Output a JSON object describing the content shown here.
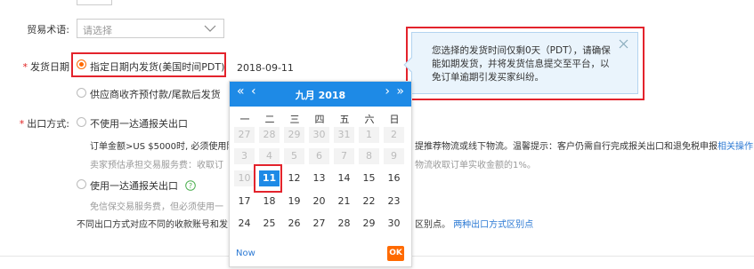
{
  "trade_terms": {
    "label": "贸易术语:",
    "placeholder": "请选择"
  },
  "ship_date": {
    "label": "发货日期",
    "option1": "指定日期内发货(美国时间PDT)",
    "option2": "供应商收齐预付款/尾款后发货",
    "date_value": "2018-09-11"
  },
  "tooltip": {
    "text": "您选择的发货时间仅剩0天（PDT），请确保能如期发货，并将发货信息提交至平台，以免订单逾期引发买家纠纷。"
  },
  "export": {
    "label": "出口方式:",
    "option1": "不使用一达通报关出口",
    "option1_desc_a": "订单金额>US $5000时, 必须使用阿",
    "option1_desc_b": "提推荐物流或线下物流。温馨提示：客户仍需自行完成报关出口和退免税申报",
    "option1_link": "相关操作",
    "option1_fee_a": "卖家预估承担交易服务费：收取订",
    "option1_fee_b": "物流收取订单实收金额的1%。",
    "option2": "使用一达通报关出口",
    "option2_desc": "免信保交易服务费，但必须使用一",
    "footnote_a": "不同出口方式对应不同的收款账号和发",
    "footnote_b": "区别点。",
    "footnote_link": "两种出口方式区别点"
  },
  "calendar": {
    "title": "九月 2018",
    "weekdays": [
      "一",
      "二",
      "三",
      "四",
      "五",
      "六",
      "日"
    ],
    "rows": [
      [
        "27",
        "28",
        "29",
        "30",
        "31",
        "1",
        "2"
      ],
      [
        "3",
        "4",
        "5",
        "6",
        "7",
        "8",
        "9"
      ],
      [
        "10",
        "11",
        "12",
        "13",
        "14",
        "15",
        "16"
      ],
      [
        "17",
        "18",
        "19",
        "20",
        "21",
        "22",
        "23"
      ],
      [
        "24",
        "25",
        "26",
        "27",
        "28",
        "29",
        "30"
      ]
    ],
    "disabled": [
      [
        0,
        1,
        2,
        3,
        4,
        5,
        6
      ],
      [
        0,
        1,
        2,
        3,
        4,
        5,
        6
      ],
      [
        0
      ],
      [],
      []
    ],
    "selected": [
      2,
      1
    ],
    "now_label": "Now",
    "ok_label": "OK"
  },
  "colors": {
    "accent": "#ff6a00",
    "primary": "#1e8ae6",
    "highlight": "#e3232c",
    "link": "#2d7ad4"
  },
  "icons": [
    "chevron-down-icon",
    "close-icon",
    "help-circle-icon",
    "double-chevron-left-icon",
    "chevron-left-icon",
    "chevron-right-icon",
    "double-chevron-right-icon"
  ]
}
